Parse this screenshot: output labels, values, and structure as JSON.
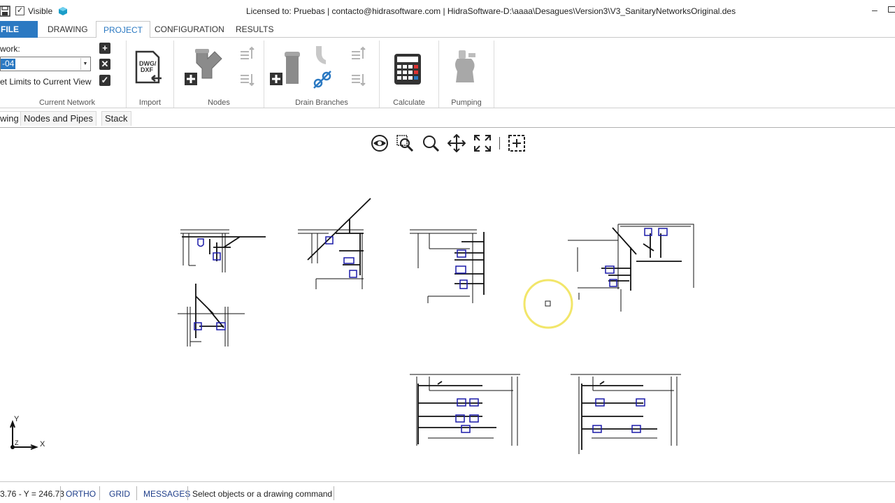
{
  "titlebar": {
    "visible_label": "Visible",
    "visible_checked": "✓",
    "title": "Licensed to: Pruebas | contacto@hidrasoftware.com | HidraSoftware-D:\\aaaa\\Desagues\\Version3\\V3_SanitaryNetworksOriginal.des",
    "minimize": "–"
  },
  "tabs": [
    "FILE",
    "DRAWING",
    "PROJECT",
    "CONFIGURATION",
    "RESULTS"
  ],
  "active_tab": "PROJECT",
  "ribbon": {
    "network_label": "work:",
    "network_value": "-04",
    "set_limits_label": "et Limits to Current View",
    "groups": {
      "current_network": "Current Network",
      "import": "Import",
      "nodes": "Nodes",
      "drain_branches": "Drain Branches",
      "calculate": "Calculate",
      "pumping": "Pumping"
    },
    "import_icon_text_1": "DWG/",
    "import_icon_text_2": "DXF"
  },
  "subtabs": [
    "wing",
    "Nodes and Pipes",
    "Stack"
  ],
  "canvas": {
    "axis_y": "Y",
    "axis_x": "X",
    "axis_z": "Z"
  },
  "status": {
    "coords": "3.76 - Y = 246.73",
    "ortho": "ORTHO",
    "grid": "GRID",
    "messages": "MESSAGES",
    "prompt": "Select objects or a drawing command"
  },
  "colors": {
    "accent": "#2b79c2",
    "cursor_highlight": "#f2e66a",
    "fixture_blue": "#1a1aa8"
  }
}
